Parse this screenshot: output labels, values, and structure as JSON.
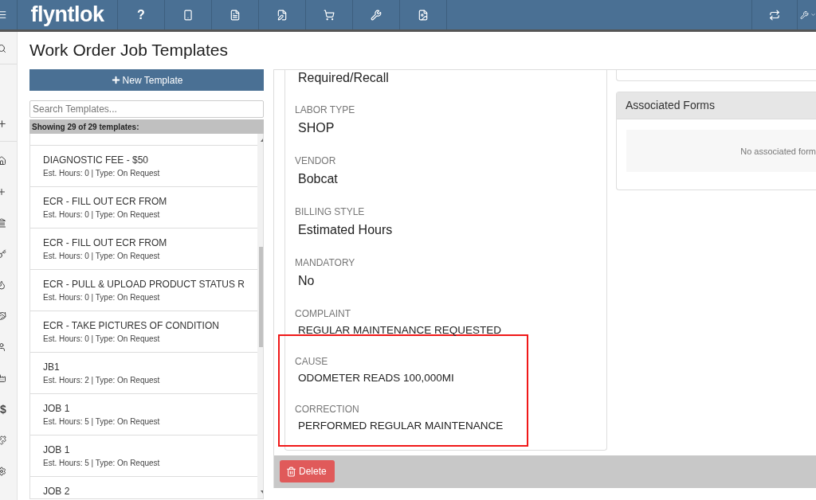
{
  "top_bar": {
    "logo": "flyntlok",
    "help": "?"
  },
  "sidebar": {
    "dollar": "$"
  },
  "page_title": "Work Order Job Templates",
  "new_template_button": "New Template",
  "search": {
    "placeholder": "Search Templates..."
  },
  "list_header": "Showing 29 of 29 templates:",
  "templates": [
    {
      "name": "DIAGNOSTIC FEE - $50",
      "details": "Est. Hours: 0 | Type: On Request",
      "selected": false
    },
    {
      "name": "ECR - FILL OUT ECR FROM",
      "details": "Est. Hours: 0 | Type: On Request",
      "selected": false
    },
    {
      "name": "ECR - FILL OUT ECR FROM",
      "details": "Est. Hours: 0 | Type: On Request",
      "selected": false
    },
    {
      "name": "ECR - PULL & UPLOAD PRODUCT STATUS R",
      "details": "Est. Hours: 0 | Type: On Request",
      "selected": false
    },
    {
      "name": "ECR - TAKE PICTURES OF CONDITION",
      "details": "Est. Hours: 0 | Type: On Request",
      "selected": false
    },
    {
      "name": "JB1",
      "details": "Est. Hours: 2 | Type: On Request",
      "selected": false
    },
    {
      "name": "JOB 1",
      "details": "Est. Hours: 5 | Type: On Request",
      "selected": false
    },
    {
      "name": "JOB 1",
      "details": "Est. Hours: 5 | Type: On Request",
      "selected": false
    },
    {
      "name": "JOB 2",
      "selected": false
    }
  ],
  "details": {
    "fields": [
      {
        "kind": "choice",
        "value": "Required/Recall",
        "highlighted": false
      },
      {
        "kind": "choice",
        "label": "LABOR TYPE",
        "value": "SHOP",
        "highlighted": false
      },
      {
        "kind": "choice",
        "label": "VENDOR",
        "value": "Bobcat",
        "highlighted": false
      },
      {
        "kind": "choice",
        "label": "BILLING STYLE",
        "value": "Estimated Hours",
        "highlighted": false
      },
      {
        "kind": "choice",
        "label": "MANDATORY",
        "value": "No",
        "highlighted": false
      },
      {
        "kind": "text",
        "label": "COMPLAINT",
        "value": "REGULAR MAINTENANCE REQUESTED",
        "highlighted": false
      },
      {
        "kind": "text",
        "label": "CAUSE",
        "value": "ODOMETER READS 100,000MI",
        "highlighted": true
      },
      {
        "kind": "text",
        "label": "CORRECTION",
        "value": "PERFORMED REGULAR MAINTENANCE",
        "highlighted": true
      }
    ]
  },
  "associated_forms": {
    "title": "Associated Forms",
    "empty_text": "No associated form"
  },
  "delete_button": "Delete"
}
